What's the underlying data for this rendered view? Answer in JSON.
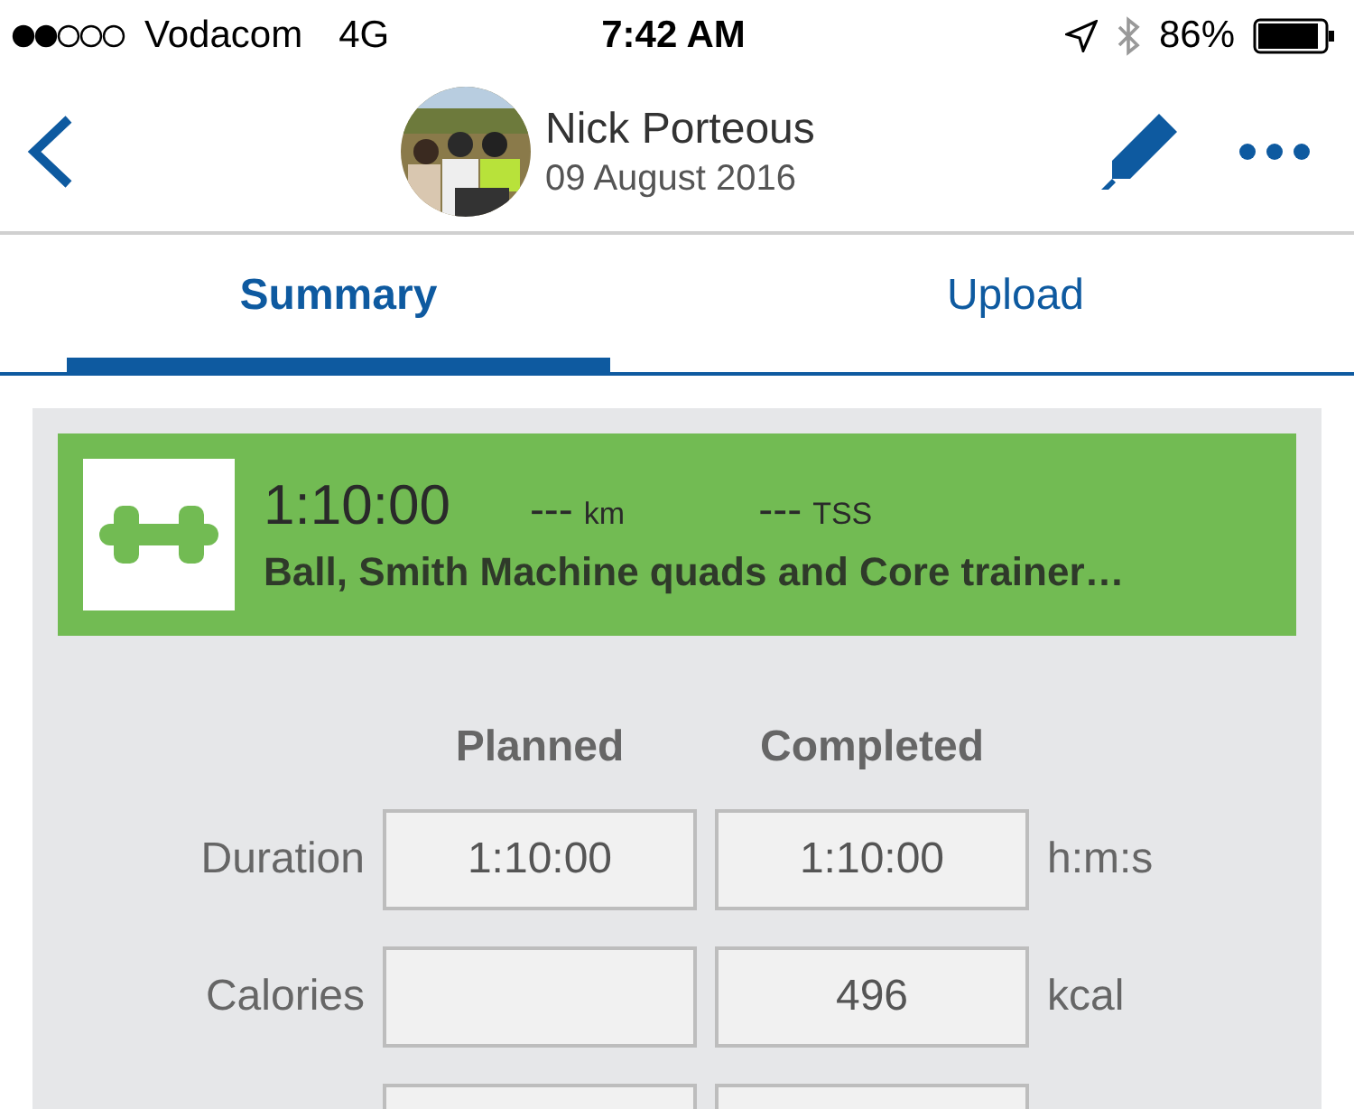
{
  "status_bar": {
    "carrier": "Vodacom",
    "network": "4G",
    "time": "7:42 AM",
    "battery": "86%"
  },
  "header": {
    "name": "Nick Porteous",
    "date": "09 August 2016"
  },
  "tabs": [
    {
      "label": "Summary",
      "selected": true
    },
    {
      "label": "Upload",
      "selected": false
    }
  ],
  "workout": {
    "duration": "1:10:00",
    "distance": "---",
    "distance_unit": "km",
    "tss": "---",
    "tss_unit": "TSS",
    "title": "Ball, Smith Machine quads and Core trainer…"
  },
  "columns": [
    "Planned",
    "Completed"
  ],
  "rows": [
    {
      "label": "Duration",
      "planned": "1:10:00",
      "completed": "1:10:00",
      "unit": "h:m:s"
    },
    {
      "label": "Calories",
      "completed": "496",
      "unit": "kcal"
    }
  ]
}
